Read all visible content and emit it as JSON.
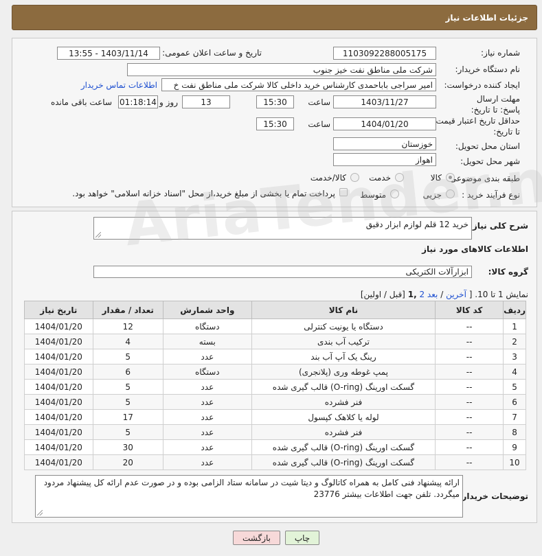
{
  "page_title": "جزئیات اطلاعات نیاز",
  "form": {
    "need_number_label": "شماره نیاز:",
    "need_number": "1103092288005175",
    "announce_label": "تاریخ و ساعت اعلان عمومی:",
    "announce_value": "1403/11/14 - 13:55",
    "buyer_org_label": "نام دستگاه خریدار:",
    "buyer_org": "شرکت ملی مناطق نفت خیز جنوب",
    "creator_label": "ایجاد کننده درخواست:",
    "creator": "امیر  سراجی باباحمدی  کارشناس خرید داخلی کالا شرکت ملی مناطق نفت خ",
    "contact_link": "اطلاعات تماس خریدار",
    "deadline_label": "مهلت ارسال پاسخ: تا تاریخ:",
    "deadline_date": "1403/11/27",
    "time_label": "ساعت",
    "deadline_time": "15:30",
    "days_value": "13",
    "days_label": "روز و",
    "remaining_value": "01:18:14",
    "remaining_label": "ساعت باقی مانده",
    "price_valid_label": "حداقل تاریخ اعتبار قیمت: تا تاریخ:",
    "price_valid_date": "1404/01/20",
    "price_valid_time": "15:30",
    "province_label": "استان محل تحویل:",
    "province": "خوزستان",
    "city_label": "شهر محل تحویل:",
    "city": "اهواز",
    "category_label": "طبقه بندی موضوعی:",
    "category_options": [
      "کالا",
      "خدمت",
      "کالا/خدمت"
    ],
    "process_label": "نوع فرآیند خرید :",
    "process_options": [
      "جزیی",
      "متوسط"
    ],
    "payment_note": "پرداخت تمام یا بخشی از مبلغ خرید،از محل \"اسناد خزانه اسلامی\" خواهد بود."
  },
  "details": {
    "summary_label": "شرح کلی نیاز:",
    "summary_value": "خرید 12 قلم لوازم ابزار دقیق",
    "goods_info_title": "اطلاعات کالاهای مورد نیاز",
    "group_label": "گروه کالا:",
    "group_value": "ابزارآلات الکتریکی",
    "pager_text": "نمایش 1 تا 10. [",
    "pager_last": "آخرین",
    "pager_next": "بعد",
    "pager_page2": "2",
    "pager_current": ",1",
    "pager_tail": "[قبل / اولین]",
    "notes_label": "توضیحات خریدار:",
    "notes_value": "ارائه پیشنهاد فنی کامل به همراه کاتالوگ و دیتا شیت در سامانه ستاد الزامی بوده و در صورت عدم ارائه کل پیشنهاد مردود میگردد. تلفن جهت اطلاعات بیشتر 23776"
  },
  "table": {
    "headers": [
      "ردیف",
      "کد کالا",
      "نام کالا",
      "واحد شمارش",
      "تعداد / مقدار",
      "تاریخ نیاز"
    ],
    "rows": [
      [
        "1",
        "--",
        "دستگاه یا یونیت کنترلی",
        "دستگاه",
        "12",
        "1404/01/20"
      ],
      [
        "2",
        "--",
        "ترکیب آب بندی",
        "بسته",
        "4",
        "1404/01/20"
      ],
      [
        "3",
        "--",
        "رینگ یک آپ آب بند",
        "عدد",
        "5",
        "1404/01/20"
      ],
      [
        "4",
        "--",
        "پمپ غوطه وری (پلانجری)",
        "دستگاه",
        "6",
        "1404/01/20"
      ],
      [
        "5",
        "--",
        "گسکت اورینگ (O-ring) قالب گیری شده",
        "عدد",
        "5",
        "1404/01/20"
      ],
      [
        "6",
        "--",
        "فنر فشرده",
        "عدد",
        "5",
        "1404/01/20"
      ],
      [
        "7",
        "--",
        "لوله یا کلاهک کپسول",
        "عدد",
        "17",
        "1404/01/20"
      ],
      [
        "8",
        "--",
        "فنر فشرده",
        "عدد",
        "5",
        "1404/01/20"
      ],
      [
        "9",
        "--",
        "گسکت اورینگ (O-ring) قالب گیری شده",
        "عدد",
        "30",
        "1404/01/20"
      ],
      [
        "10",
        "--",
        "گسکت اورینگ (O-ring) قالب گیری شده",
        "عدد",
        "20",
        "1404/01/20"
      ]
    ]
  },
  "buttons": {
    "print": "چاپ",
    "back": "بازگشت"
  },
  "colors": {
    "header_bg": "#8c6b3f",
    "link": "#1d4fd0",
    "back_button_bg": "#f7d9d9",
    "print_button_bg": "#e2f3d8"
  },
  "watermark": "AriaTender.neT"
}
